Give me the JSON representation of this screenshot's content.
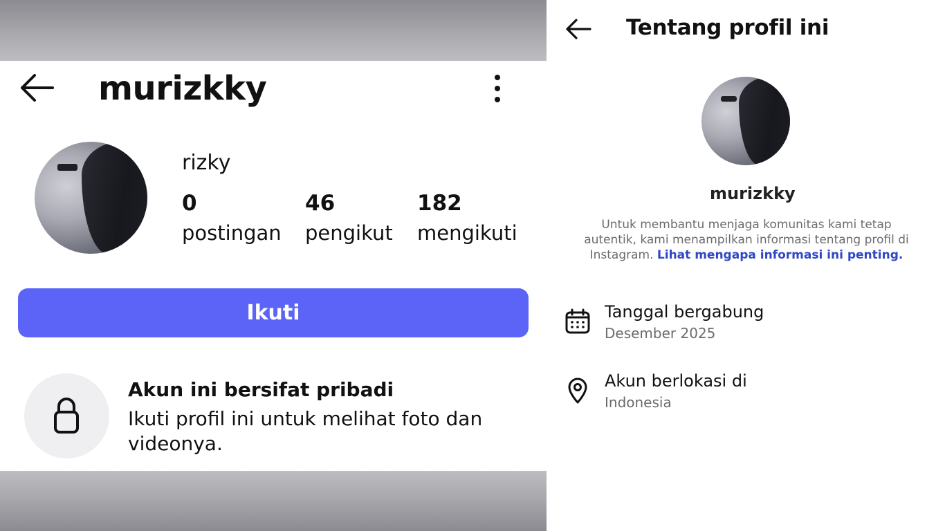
{
  "left_panel": {
    "header": {
      "back_icon": "arrow-left-icon",
      "username": "murizkky",
      "more_icon": "more-vertical-icon"
    },
    "profile": {
      "display_name": "rizky",
      "stats": [
        {
          "value": "0",
          "label": "postingan"
        },
        {
          "value": "46",
          "label": "pengikut"
        },
        {
          "value": "182",
          "label": "mengikuti"
        }
      ]
    },
    "follow_button": "Ikuti",
    "private_notice": {
      "icon": "lock-icon",
      "title": "Akun ini bersifat pribadi",
      "description": "Ikuti profil ini untuk melihat foto dan videonya."
    }
  },
  "right_panel": {
    "header": {
      "back_icon": "arrow-left-icon",
      "title": "Tentang profil ini"
    },
    "username": "murizkky",
    "info_text": "Untuk membantu menjaga komunitas kami tetap autentik, kami menampilkan informasi tentang profil di Instagram.",
    "info_link": "Lihat mengapa informasi ini penting.",
    "rows": [
      {
        "icon": "calendar-icon",
        "title": "Tanggal bergabung",
        "value": "Desember 2025"
      },
      {
        "icon": "location-pin-icon",
        "title": "Akun berlokasi di",
        "value": "Indonesia"
      }
    ]
  },
  "colors": {
    "follow_button": "#5b64f7",
    "link": "#2f47c5",
    "muted_text": "#6b6b70"
  }
}
